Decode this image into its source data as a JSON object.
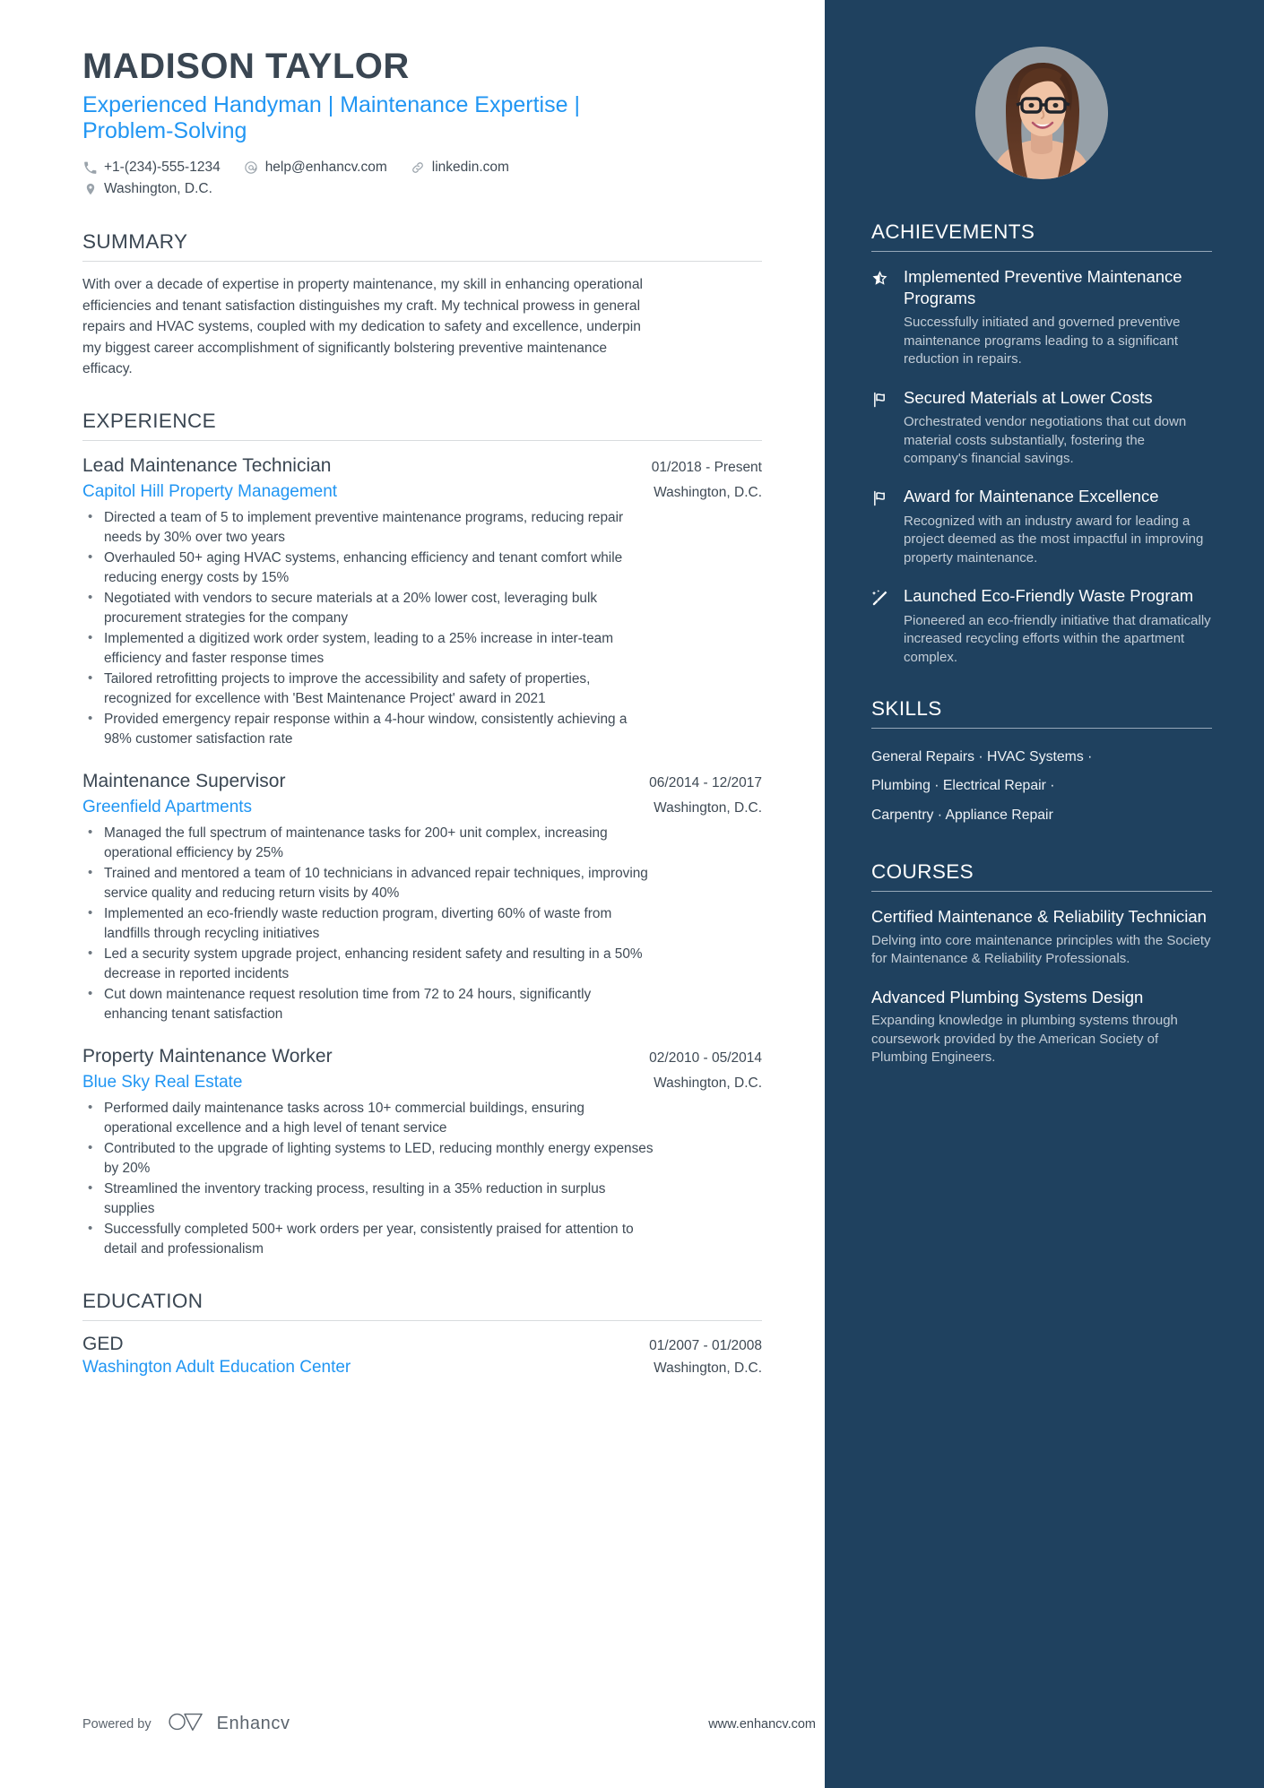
{
  "header": {
    "name": "MADISON TAYLOR",
    "headline": "Experienced Handyman | Maintenance Expertise | Problem-Solving",
    "contacts": [
      {
        "icon": "phone-icon",
        "text": "+1-(234)-555-1234"
      },
      {
        "icon": "email-icon",
        "text": "help@enhancv.com"
      },
      {
        "icon": "link-icon",
        "text": "linkedin.com"
      }
    ],
    "location": {
      "icon": "location-pin-icon",
      "text": "Washington, D.C."
    }
  },
  "summary": {
    "title": "SUMMARY",
    "text": "With over a decade of expertise in property maintenance, my skill in enhancing operational efficiencies and tenant satisfaction distinguishes my craft. My technical prowess in general repairs and HVAC systems, coupled with my dedication to safety and excellence, underpin my biggest career accomplishment of significantly bolstering preventive maintenance efficacy."
  },
  "experience": {
    "title": "EXPERIENCE",
    "jobs": [
      {
        "title": "Lead Maintenance Technician",
        "date": "01/2018 - Present",
        "company": "Capitol Hill Property Management",
        "location": "Washington, D.C.",
        "bullets": [
          "Directed a team of 5 to implement preventive maintenance programs, reducing repair needs by 30% over two years",
          "Overhauled 50+ aging HVAC systems, enhancing efficiency and tenant comfort while reducing energy costs by 15%",
          "Negotiated with vendors to secure materials at a 20% lower cost, leveraging bulk procurement strategies for the company",
          "Implemented a digitized work order system, leading to a 25% increase in inter-team efficiency and faster response times",
          "Tailored retrofitting projects to improve the accessibility and safety of properties, recognized for excellence with 'Best Maintenance Project' award in 2021",
          "Provided emergency repair response within a 4-hour window, consistently achieving a 98% customer satisfaction rate"
        ]
      },
      {
        "title": "Maintenance Supervisor",
        "date": "06/2014 - 12/2017",
        "company": "Greenfield Apartments",
        "location": "Washington, D.C.",
        "bullets": [
          "Managed the full spectrum of maintenance tasks for 200+ unit complex, increasing operational efficiency by 25%",
          "Trained and mentored a team of 10 technicians in advanced repair techniques, improving service quality and reducing return visits by 40%",
          "Implemented an eco-friendly waste reduction program, diverting 60% of waste from landfills through recycling initiatives",
          "Led a security system upgrade project, enhancing resident safety and resulting in a 50% decrease in reported incidents",
          "Cut down maintenance request resolution time from 72 to 24 hours, significantly enhancing tenant satisfaction"
        ]
      },
      {
        "title": "Property Maintenance Worker",
        "date": "02/2010 - 05/2014",
        "company": "Blue Sky Real Estate",
        "location": "Washington, D.C.",
        "bullets": [
          "Performed daily maintenance tasks across 10+ commercial buildings, ensuring operational excellence and a high level of tenant service",
          "Contributed to the upgrade of lighting systems to LED, reducing monthly energy expenses by 20%",
          "Streamlined the inventory tracking process, resulting in a 35% reduction in surplus supplies",
          "Successfully completed 500+ work orders per year, consistently praised for attention to detail and professionalism"
        ]
      }
    ]
  },
  "education": {
    "title": "EDUCATION",
    "entries": [
      {
        "degree": "GED",
        "date": "01/2007 - 01/2008",
        "school": "Washington Adult Education Center",
        "location": "Washington, D.C."
      }
    ]
  },
  "achievements": {
    "title": "ACHIEVEMENTS",
    "items": [
      {
        "icon": "half-star-icon",
        "title": "Implemented Preventive Maintenance Programs",
        "description": "Successfully initiated and governed preventive maintenance programs leading to a significant reduction in repairs."
      },
      {
        "icon": "flag-icon",
        "title": "Secured Materials at Lower Costs",
        "description": "Orchestrated vendor negotiations that cut down material costs substantially, fostering the company's financial savings."
      },
      {
        "icon": "flag-icon",
        "title": "Award for Maintenance Excellence",
        "description": "Recognized with an industry award for leading a project deemed as the most impactful in improving property maintenance."
      },
      {
        "icon": "magic-wand-icon",
        "title": "Launched Eco-Friendly Waste Program",
        "description": "Pioneered an eco-friendly initiative that dramatically increased recycling efforts within the apartment complex."
      }
    ]
  },
  "skills": {
    "title": "SKILLS",
    "lines": [
      "General Repairs · HVAC Systems ·",
      "Plumbing · Electrical Repair ·",
      "Carpentry · Appliance Repair"
    ]
  },
  "courses": {
    "title": "COURSES",
    "items": [
      {
        "title": "Certified Maintenance & Reliability Technician",
        "description": "Delving into core maintenance principles with the Society for Maintenance & Reliability Professionals."
      },
      {
        "title": "Advanced Plumbing Systems Design",
        "description": "Expanding knowledge in plumbing systems through coursework provided by the American Society of Plumbing Engineers."
      }
    ]
  },
  "footer": {
    "powered_label": "Powered by",
    "brand_name": "Enhancv",
    "website": "www.enhancv.com"
  },
  "colors": {
    "accent_blue": "#2196f3",
    "sidebar_bg": "#1f415f",
    "text_dark": "#3f4a55",
    "heading": "#3a4652"
  }
}
